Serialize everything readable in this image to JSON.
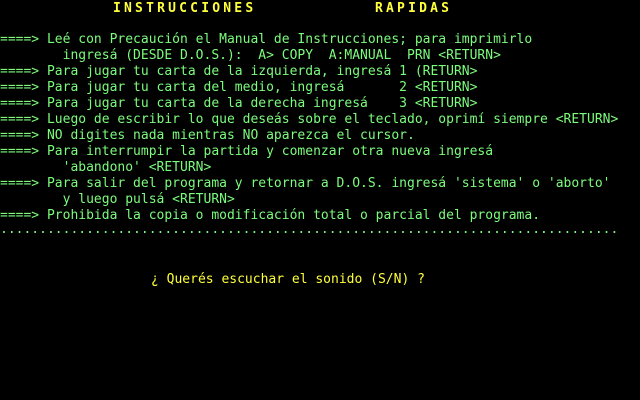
{
  "title": {
    "word1": "INSTRUCCIONES",
    "word2": "RAPIDAS"
  },
  "instructions": [
    "====> Leé con Precaución el Manual de Instrucciones; para imprimirlo",
    "        ingresá (DESDE D.O.S.):  A> COPY  A:MANUAL  PRN <RETURN>",
    "====> Para jugar tu carta de la izquierda, ingresá 1 (RETURN>",
    "====> Para jugar tu carta del medio, ingresá       2 <RETURN>",
    "====> Para jugar tu carta de la derecha ingresá    3 <RETURN>",
    "====> Luego de escribir lo que deseás sobre el teclado, oprimí siempre <RETURN>",
    "====> NO digites nada mientras NO aparezca el cursor.",
    "====> Para interrumpir la partida y comenzar otra nueva ingresá",
    "        'abandono' <RETURN>",
    "====> Para salir del programa y retornar a D.O.S. ingresá 'sistema' o 'aborto'",
    "        y luego pulsá <RETURN>",
    "====> Prohibida la copia o modificación total o parcial del programa."
  ],
  "separator": "...............................................................................",
  "prompt": "¿ Querés escuchar el sonido (S/N) ?",
  "colors": {
    "background": "#000000",
    "text": "#7cfc7c",
    "highlight": "#ffff3c"
  }
}
